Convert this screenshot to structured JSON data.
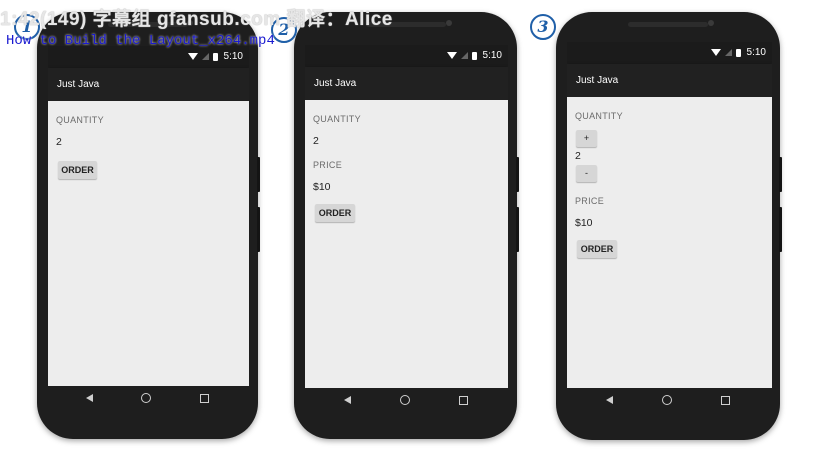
{
  "overlay": {
    "line1": "1:42(149) 字幕组 gfansub.com 翻译：Alice",
    "line2": "How to Build the Layout_x264.mp4"
  },
  "steps": [
    "1",
    "2",
    "3"
  ],
  "status_bar": {
    "time": "5:10"
  },
  "app_title": "Just Java",
  "phones": {
    "one": {
      "quantity_label": "QUANTITY",
      "quantity_value": "2",
      "order_button": "ORDER"
    },
    "two": {
      "quantity_label": "QUANTITY",
      "quantity_value": "2",
      "price_label": "PRICE",
      "price_value": "$10",
      "order_button": "ORDER"
    },
    "three": {
      "quantity_label": "QUANTITY",
      "increment_button": "+",
      "quantity_value": "2",
      "decrement_button": "-",
      "price_label": "PRICE",
      "price_value": "$10",
      "order_button": "ORDER"
    }
  },
  "nav_icons": [
    "back-icon",
    "home-icon",
    "recents-icon"
  ]
}
